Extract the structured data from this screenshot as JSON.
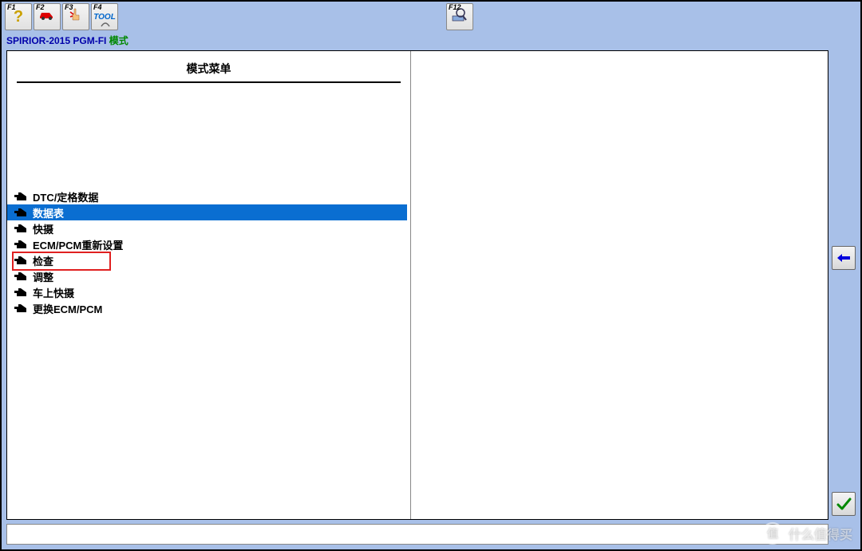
{
  "toolbar": {
    "f1": "F1",
    "f2": "F2",
    "f3": "F3",
    "f4": "F4",
    "f12": "F12",
    "f4_text": "TOOL"
  },
  "breadcrumb": {
    "vehicle": "SPIRIOR-2015",
    "system": "PGM-FI",
    "mode": "模式"
  },
  "panel": {
    "title": "模式菜单"
  },
  "menu": {
    "items": [
      {
        "label": "DTC/定格数据",
        "selected": false,
        "redbox": false
      },
      {
        "label": "数据表",
        "selected": true,
        "redbox": false
      },
      {
        "label": "快摄",
        "selected": false,
        "redbox": false
      },
      {
        "label": "ECM/PCM重新设置",
        "selected": false,
        "redbox": false
      },
      {
        "label": "检查",
        "selected": false,
        "redbox": true
      },
      {
        "label": "调整",
        "selected": false,
        "redbox": false
      },
      {
        "label": "车上快摄",
        "selected": false,
        "redbox": false
      },
      {
        "label": "更换ECM/PCM",
        "selected": false,
        "redbox": false
      }
    ]
  },
  "watermark": {
    "badge": "值",
    "text": "什么值得买"
  }
}
